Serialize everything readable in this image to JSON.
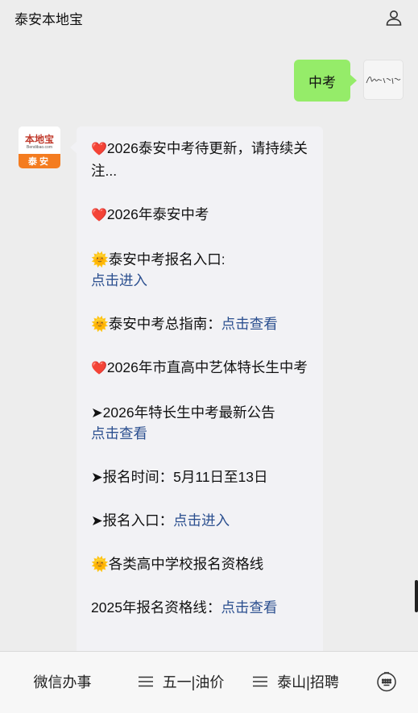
{
  "header": {
    "title": "泰安本地宝",
    "user_icon": "user-icon"
  },
  "self_message": {
    "text": "中考",
    "avatar_text": "虚心学一生"
  },
  "bot": {
    "avatar_logo": "本地宝",
    "avatar_sub": "Bendibao.com",
    "avatar_city": "泰安"
  },
  "reply": {
    "l1_text": "2026泰安中考待更新，请持续关注...",
    "l2_text": "2026年泰安中考",
    "l3_text": "泰安中考报名入口:",
    "l3_link": "点击进入",
    "l4_text": "泰安中考总指南：",
    "l4_link": "点击查看",
    "l5_text": "2026年市直高中艺体特长生中考",
    "l6_text": "➤2026年特长生中考最新公告",
    "l6_link": "点击查看",
    "l7_text": "➤报名时间：5月11日至13日",
    "l8_text": "➤报名入口：",
    "l8_link": "点击进入",
    "l9_text": "各类高中学校报名资格线",
    "l10_text": "2025年报名资格线：",
    "l10_link": "点击查看"
  },
  "menu": {
    "item1": "微信办事",
    "item2": "五一|油价",
    "item3": "泰山|招聘",
    "keyboard_icon": "keyboard-icon"
  }
}
